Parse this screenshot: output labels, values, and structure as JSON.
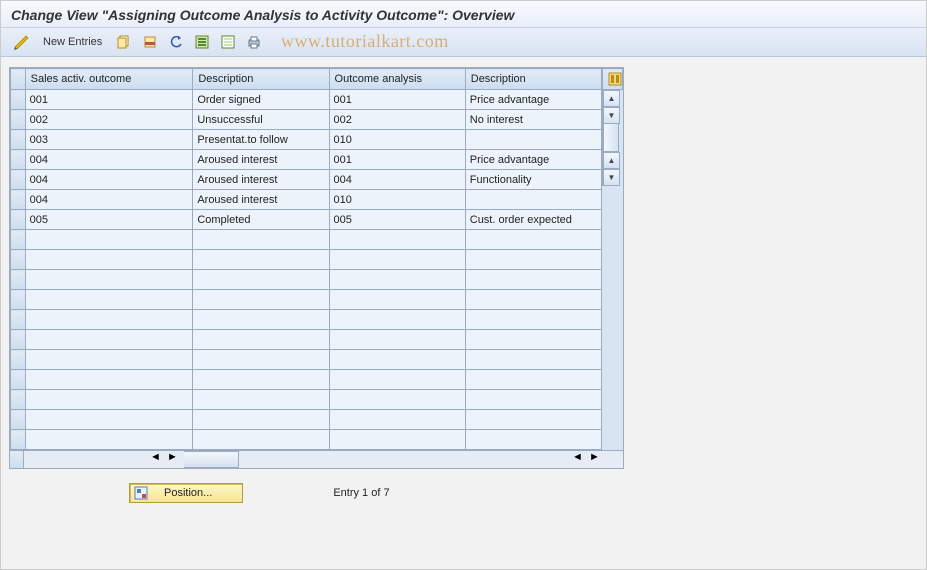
{
  "title": "Change View \"Assigning Outcome Analysis to Activity Outcome\": Overview",
  "toolbar": {
    "new_entries_label": "New Entries"
  },
  "watermark": "www.tutorialkart.com",
  "table": {
    "columns": [
      "Sales activ. outcome",
      "Description",
      "Outcome analysis",
      "Description"
    ],
    "rows": [
      {
        "outcome": "001",
        "desc": "Order signed",
        "analysis": "001",
        "adesc": "Price advantage"
      },
      {
        "outcome": "002",
        "desc": "Unsuccessful",
        "analysis": "002",
        "adesc": "No interest"
      },
      {
        "outcome": "003",
        "desc": "Presentat.to follow",
        "analysis": "010",
        "adesc": ""
      },
      {
        "outcome": "004",
        "desc": "Aroused interest",
        "analysis": "001",
        "adesc": "Price advantage"
      },
      {
        "outcome": "004",
        "desc": "Aroused interest",
        "analysis": "004",
        "adesc": "Functionality"
      },
      {
        "outcome": "004",
        "desc": "Aroused interest",
        "analysis": "010",
        "adesc": ""
      },
      {
        "outcome": "005",
        "desc": "Completed",
        "analysis": "005",
        "adesc": "Cust. order expected"
      }
    ],
    "empty_rows": 11
  },
  "footer": {
    "position_label": "Position...",
    "entry_status": "Entry 1 of 7"
  },
  "colors": {
    "header_bg": "#e2ebf6",
    "cell_bg": "#edf3fb",
    "border": "#9aabc2",
    "button_bg": "#f6e68f"
  }
}
